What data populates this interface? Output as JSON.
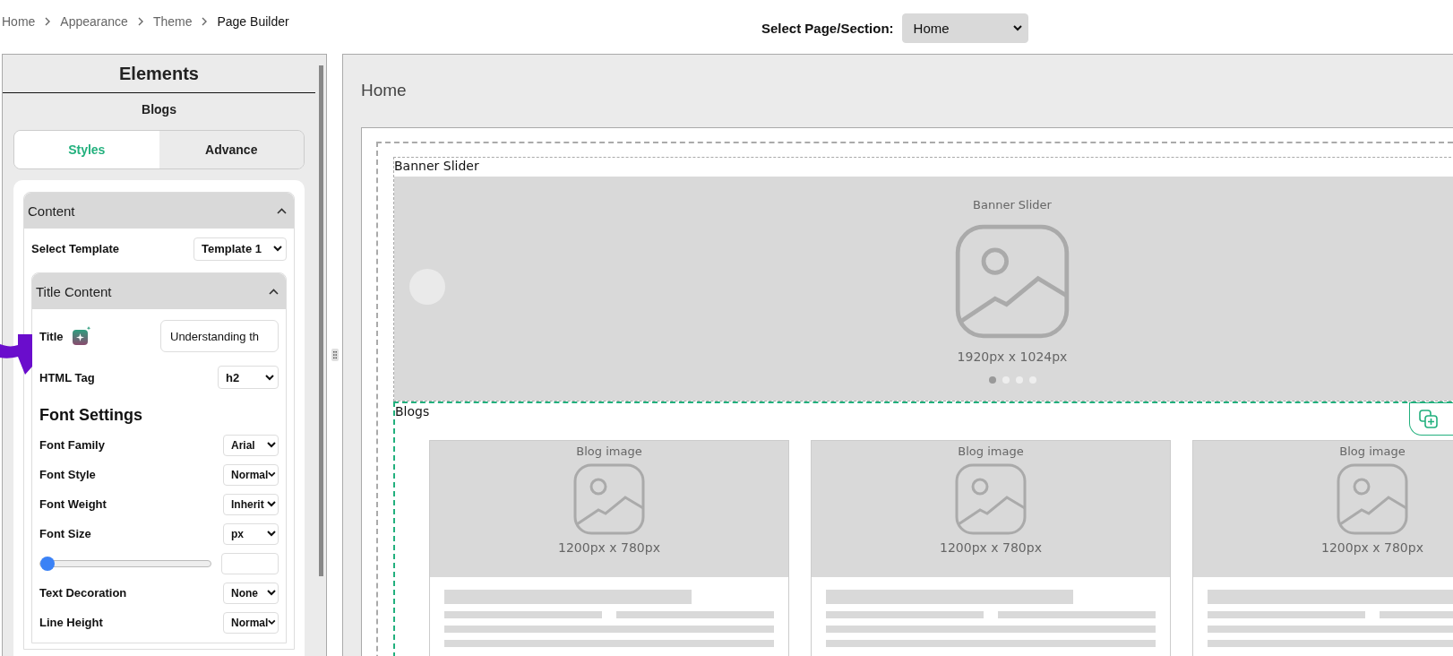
{
  "breadcrumb": [
    {
      "label": "Home",
      "current": false
    },
    {
      "label": "Appearance",
      "current": false
    },
    {
      "label": "Theme",
      "current": false
    },
    {
      "label": "Page Builder",
      "current": true
    }
  ],
  "page_select": {
    "label": "Select Page/Section:",
    "value": "Home"
  },
  "sidebar": {
    "title": "Elements",
    "element": "Blogs",
    "tabs": [
      {
        "label": "Styles",
        "selected": true
      },
      {
        "label": "Advance",
        "selected": false
      }
    ],
    "content": {
      "title": "Content",
      "expanded": true,
      "template": {
        "label": "Select Template",
        "value": "Template 1"
      },
      "title_content": {
        "title": "Title Content",
        "expanded": true,
        "title_field": {
          "label": "Title",
          "value": "Understanding th"
        },
        "html_tag": {
          "label": "HTML Tag",
          "value": "h2"
        }
      },
      "font_settings": {
        "title": "Font Settings",
        "rows": [
          {
            "kind": "select",
            "label": "Font Family",
            "value": "Arial"
          },
          {
            "kind": "select",
            "label": "Font Style",
            "value": "Normal"
          },
          {
            "kind": "select",
            "label": "Font Weight",
            "value": "Inherit"
          },
          {
            "kind": "select",
            "label": "Font Size",
            "value": "px"
          },
          {
            "kind": "slider",
            "level": 0
          },
          {
            "kind": "select",
            "label": "Text Decoration",
            "value": "None"
          },
          {
            "kind": "select",
            "label": "Line Height",
            "value": "Normal"
          }
        ]
      }
    }
  },
  "canvas": {
    "title": "Home",
    "sections": [
      {
        "kind": "banner",
        "label": "Banner Slider",
        "selected": false,
        "caption": "Banner Slider",
        "size": "1920px x 1024px"
      },
      {
        "kind": "blogs",
        "label": "Blogs",
        "selected": true,
        "cards": [
          {
            "caption": "Blog image",
            "size": "1200px x 780px"
          },
          {
            "caption": "Blog image",
            "size": "1200px x 780px"
          },
          {
            "caption": "Blog image",
            "size": "1200px x 780px"
          }
        ]
      }
    ]
  }
}
